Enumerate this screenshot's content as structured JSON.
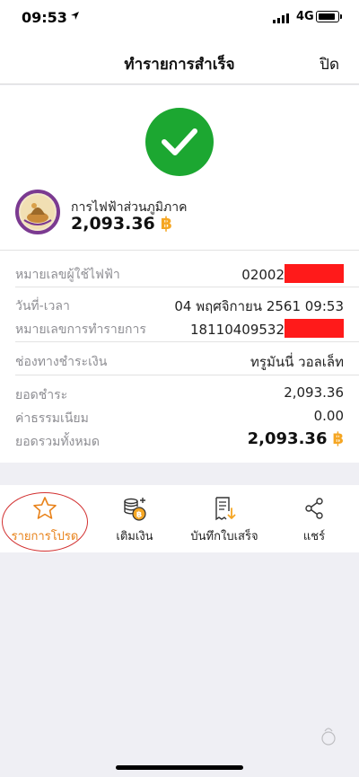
{
  "status": {
    "time": "09:53",
    "network": "4G"
  },
  "nav": {
    "title": "ทำรายการสำเร็จ",
    "close_label": "ปิด"
  },
  "payee": {
    "name": "การไฟฟ้าส่วนภูมิภาค",
    "amount": "2,093.36",
    "currency_symbol": "฿"
  },
  "details": [
    {
      "label": "หมายเลขผู้ใช้ไฟฟ้า",
      "value": "02002",
      "redacted": true
    },
    {
      "label": "วันที่-เวลา",
      "value": "04 พฤศจิกายน 2561 09:53"
    },
    {
      "label": "หมายเลขการทำรายการ",
      "value": "18110409532",
      "redacted": true
    },
    {
      "label": "ช่องทางชำระเงิน",
      "value": "ทรูมันนี่ วอลเล็ท"
    },
    {
      "label": "ยอดชำระ",
      "value": "2,093.36"
    },
    {
      "label": "ค่าธรรมเนียม",
      "value": "0.00"
    },
    {
      "label": "ยอดรวมทั้งหมด",
      "value": "2,093.36"
    }
  ],
  "actions": [
    {
      "label": "รายการโปรด",
      "icon": "star-icon"
    },
    {
      "label": "เติมเงิน",
      "icon": "coin-add-icon"
    },
    {
      "label": "บันทึกใบเสร็จ",
      "icon": "save-receipt-icon"
    },
    {
      "label": "แชร์",
      "icon": "share-icon"
    }
  ],
  "colors": {
    "success": "#1ca731",
    "accent": "#f5a623",
    "favorite": "#e8821a",
    "annotation": "#d23030",
    "redaction": "#ff1a1a"
  }
}
